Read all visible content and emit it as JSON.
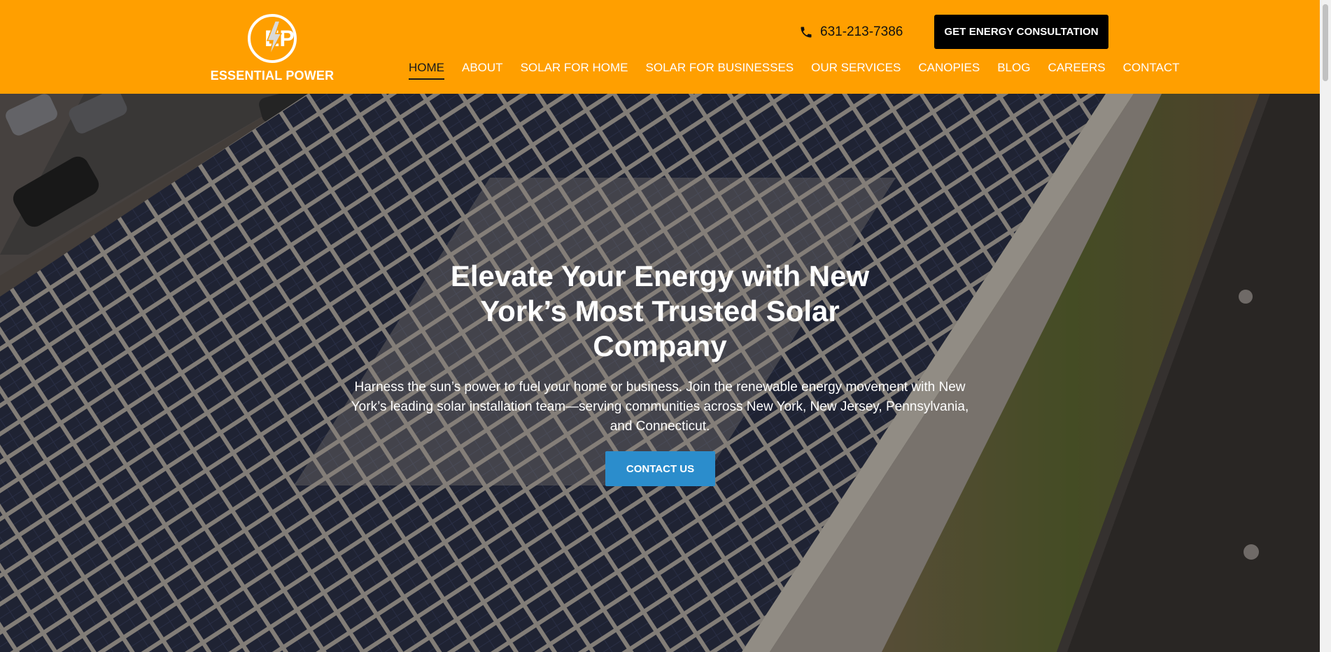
{
  "brand": {
    "logo_text": "ESSENTIAL POWER",
    "logo_initials": "EP",
    "header_color": "#ff9f00"
  },
  "header": {
    "phone_icon": "phone-icon",
    "phone": "631-213-7386",
    "cta_label": "GET ENERGY CONSULTATION",
    "nav": [
      {
        "label": "HOME",
        "active": true
      },
      {
        "label": "ABOUT"
      },
      {
        "label": "SOLAR FOR HOME"
      },
      {
        "label": "SOLAR FOR BUSINESSES"
      },
      {
        "label": "OUR SERVICES"
      },
      {
        "label": "CANOPIES"
      },
      {
        "label": "BLOG"
      },
      {
        "label": "CAREERS"
      },
      {
        "label": "CONTACT"
      }
    ]
  },
  "hero": {
    "title": "Elevate Your Energy with New York’s Most Trusted Solar Company",
    "subtitle": "Harness the sun’s power to fuel your home or business. Join the renewable energy movement with New York’s leading solar installation team—serving communities across New York, New Jersey, Pennsylvania, and Connecticut.",
    "button_label": "CONTACT US",
    "button_color": "#2b8dcc",
    "background": "aerial photo of solar panels on a commercial rooftop"
  }
}
